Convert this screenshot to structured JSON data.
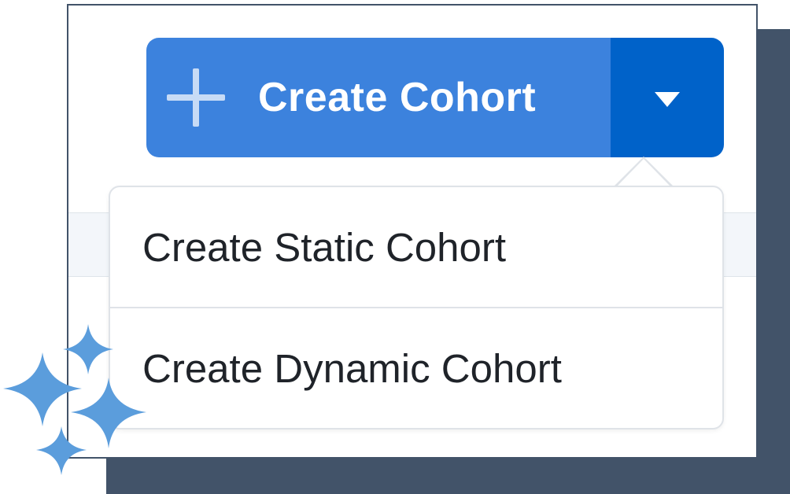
{
  "colors": {
    "primary": "#3c82dd",
    "primary_dark": "#0062c9",
    "sparkle": "#5b9ddc",
    "shadow": "#425369"
  },
  "create_button": {
    "label": "Create Cohort",
    "icon": "plus-icon",
    "toggle_icon": "caret-down-icon"
  },
  "dropdown": {
    "items": [
      {
        "label": "Create Static Cohort"
      },
      {
        "label": "Create Dynamic Cohort"
      }
    ]
  },
  "decoration": {
    "icon": "sparkles-icon"
  }
}
